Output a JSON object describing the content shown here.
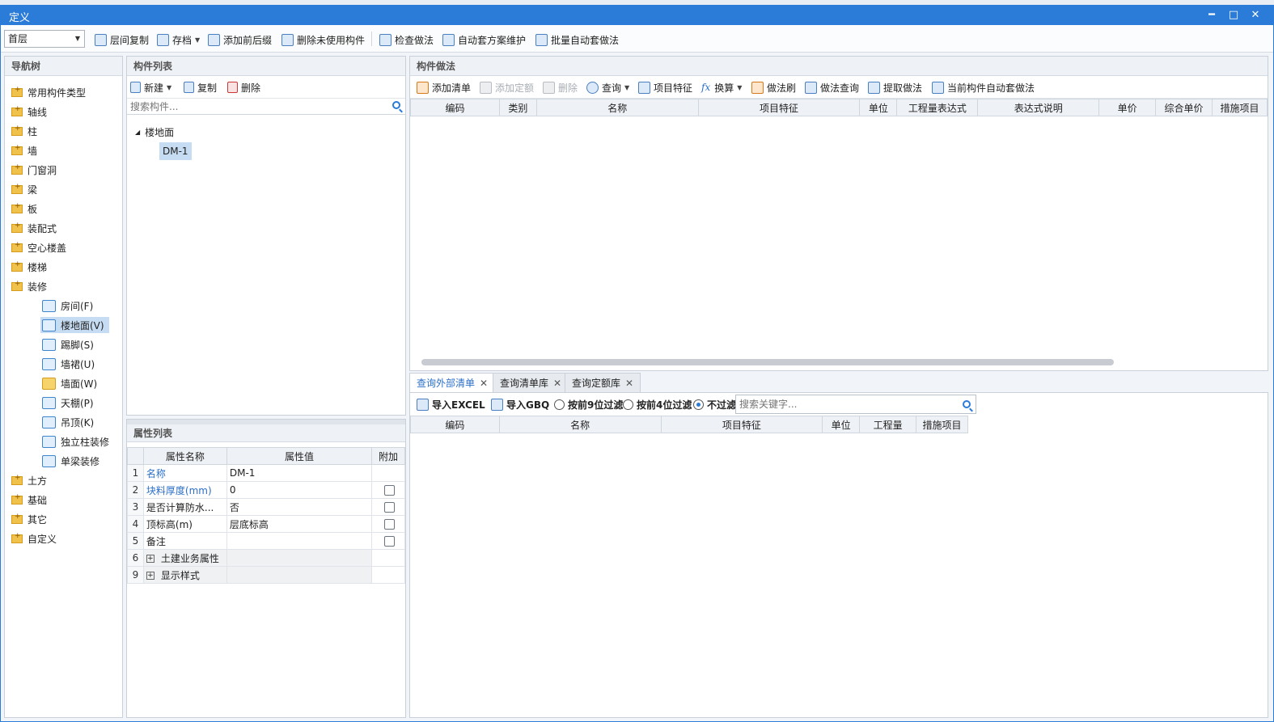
{
  "window": {
    "title": "定义",
    "min": "━",
    "max": "□",
    "close": "✕"
  },
  "toolbar": {
    "floor": "首层",
    "buttons": [
      "层间复制",
      "存档",
      "添加前后缀",
      "删除未使用构件",
      "检查做法",
      "自动套方案维护",
      "批量自动套做法"
    ]
  },
  "nav": {
    "title": "导航树",
    "items": [
      "常用构件类型",
      "轴线",
      "柱",
      "墙",
      "门窗洞",
      "梁",
      "板",
      "装配式",
      "空心楼盖",
      "楼梯",
      "装修"
    ],
    "sub": [
      "房间(F)",
      "楼地面(V)",
      "踢脚(S)",
      "墙裙(U)",
      "墙面(W)",
      "天棚(P)",
      "吊顶(K)",
      "独立柱装修",
      "单梁装修"
    ],
    "items_after": [
      "土方",
      "基础",
      "其它",
      "自定义"
    ]
  },
  "components": {
    "title": "构件列表",
    "new": "新建",
    "copy": "复制",
    "delete": "删除",
    "search_placeholder": "搜索构件...",
    "group": "楼地面",
    "item": "DM-1"
  },
  "properties": {
    "title": "属性列表",
    "headers": [
      "属性名称",
      "属性值",
      "附加"
    ],
    "rows": [
      {
        "n": "1",
        "name": "名称",
        "value": "DM-1"
      },
      {
        "n": "2",
        "name": "块料厚度(mm)",
        "value": "0"
      },
      {
        "n": "3",
        "name": "是否计算防水...",
        "value": "否"
      },
      {
        "n": "4",
        "name": "顶标高(m)",
        "value": "层底标高"
      },
      {
        "n": "5",
        "name": "备注",
        "value": ""
      },
      {
        "n": "6",
        "name": "土建业务属性",
        "value": ""
      },
      {
        "n": "9",
        "name": "显示样式",
        "value": ""
      }
    ]
  },
  "method": {
    "title": "构件做法",
    "buttons": [
      "添加清单",
      "添加定额",
      "删除",
      "查询",
      "项目特征",
      "换算",
      "做法刷",
      "做法查询",
      "提取做法",
      "当前构件自动套做法"
    ],
    "headers": [
      "编码",
      "类别",
      "名称",
      "项目特征",
      "单位",
      "工程量表达式",
      "表达式说明",
      "单价",
      "综合单价",
      "措施项目"
    ]
  },
  "query": {
    "tabs": [
      "查询外部清单",
      "查询清单库",
      "查询定额库"
    ],
    "import_excel": "导入EXCEL",
    "import_gbq": "导入GBQ",
    "filters": [
      "按前9位过滤",
      "按前4位过滤",
      "不过滤"
    ],
    "search_placeholder": "搜索关键字...",
    "headers": [
      "编码",
      "名称",
      "项目特征",
      "单位",
      "工程量",
      "措施项目"
    ]
  }
}
